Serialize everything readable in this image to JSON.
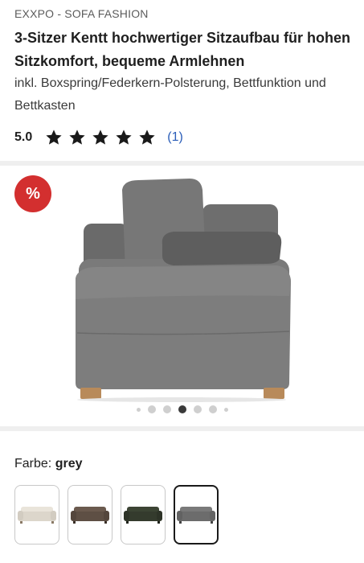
{
  "product": {
    "brand": "EXXPO - SOFA FASHION",
    "title": "3-Sitzer Kentt hochwertiger Sitzaufbau für hohen Sitzkomfort, bequeme Armlehnen",
    "subtitle": "inkl. Boxspring/Federkern-Polsterung, Bettfunktion und Bettkasten"
  },
  "rating": {
    "value": "5.0",
    "stars": 5,
    "count": "(1)",
    "star_color": "#1a1a1a"
  },
  "gallery": {
    "badge": "%",
    "badge_color": "#d32f2f",
    "image_icon": "grey-sofa-image",
    "dots_total": 7,
    "active_dot": 3
  },
  "color": {
    "label": "Farbe:",
    "selected": "grey",
    "options": [
      {
        "name": "cream",
        "color": "#e9e4da",
        "selected": false
      },
      {
        "name": "brown",
        "color": "#6b5a4e",
        "selected": false
      },
      {
        "name": "green",
        "color": "#3c4434",
        "selected": false
      },
      {
        "name": "grey",
        "color": "#7a7a7a",
        "selected": true
      }
    ]
  }
}
